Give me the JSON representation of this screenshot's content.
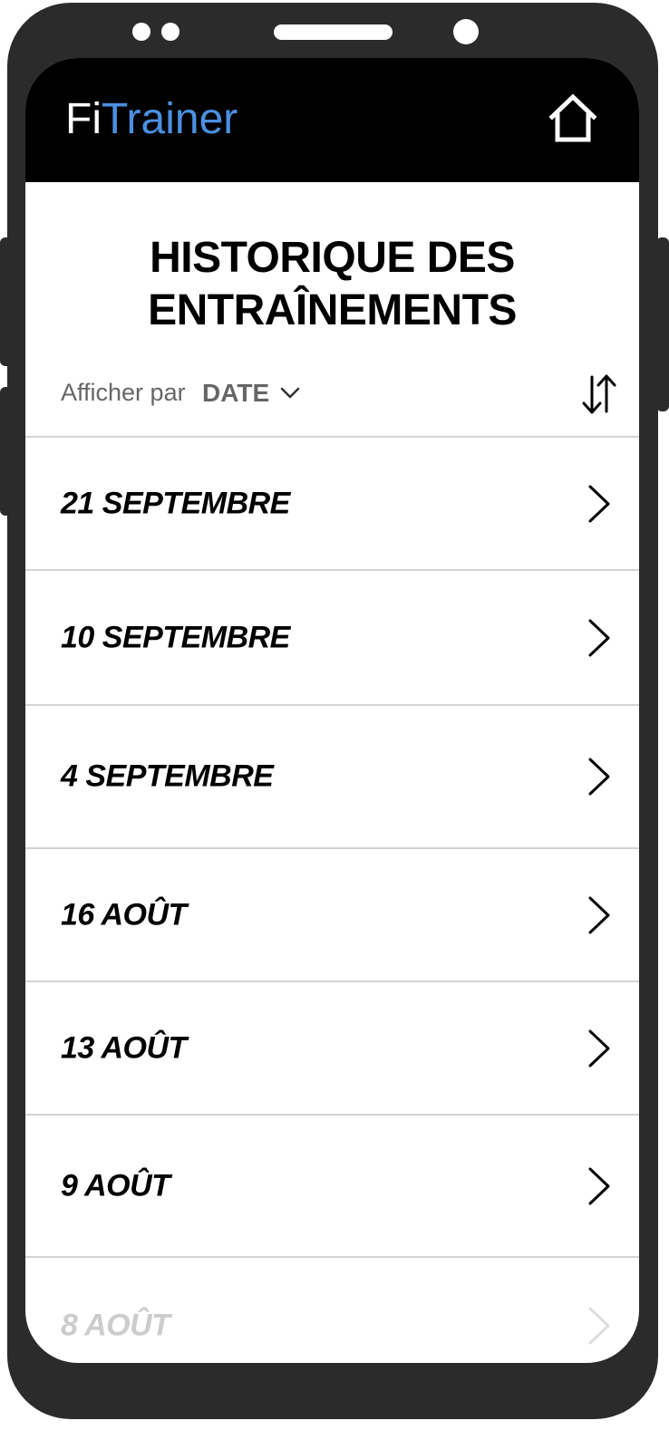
{
  "app": {
    "logo_part1": "Fi",
    "logo_part2": "Trainer",
    "brand_color": "#4a90e2",
    "header_bg": "#000000"
  },
  "header": {
    "home_icon": "home-icon"
  },
  "page": {
    "title_line1": "HISTORIQUE DES",
    "title_line2": "ENTRAÎNEMENTS"
  },
  "sort": {
    "label": "Afficher par",
    "value": "DATE",
    "dropdown_icon": "chevron-down-icon",
    "order_icon": "sort-order-icon"
  },
  "workouts": [
    {
      "label": "21 SEPTEMBRE"
    },
    {
      "label": "10 SEPTEMBRE"
    },
    {
      "label": "4 SEPTEMBRE"
    },
    {
      "label": "16 AOÛT"
    },
    {
      "label": "13 AOÛT"
    },
    {
      "label": "9 AOÛT"
    },
    {
      "label": "8 AOÛT"
    }
  ]
}
